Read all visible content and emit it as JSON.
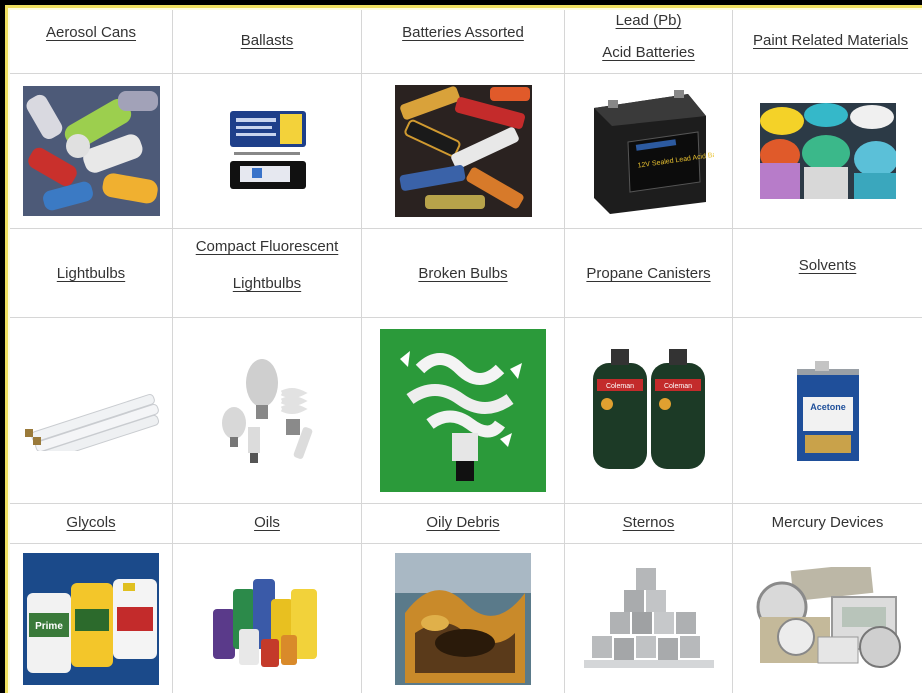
{
  "items": [
    {
      "label": "Aerosol Cans",
      "linked": true
    },
    {
      "label": "Ballasts",
      "linked": true
    },
    {
      "label": "Batteries Assorted",
      "linked": true
    },
    {
      "label_lines": [
        "Lead (Pb)",
        "Acid Batteries"
      ],
      "linked": true
    },
    {
      "label": "Paint Related Materials",
      "linked": true
    },
    {
      "label": "Lightbulbs",
      "linked": true
    },
    {
      "label_lines": [
        "Compact Fluorescent",
        "Lightbulbs"
      ],
      "linked": true
    },
    {
      "label": "Broken Bulbs",
      "linked": true
    },
    {
      "label": "Propane Canisters",
      "linked": true
    },
    {
      "label": "Solvents",
      "linked": true
    },
    {
      "label": "Glycols",
      "linked": true
    },
    {
      "label": "Oils",
      "linked": true
    },
    {
      "label": "Oily Debris",
      "linked": true
    },
    {
      "label": "Sternos",
      "linked": true
    },
    {
      "label": "Mercury Devices",
      "linked": false
    }
  ],
  "image_text": {
    "battery_label": "12V Sealed Lead Acid Battery",
    "acetone_label": "Acetone",
    "coleman_label": "Coleman",
    "prime_label": "Prime"
  },
  "colors": {
    "frame": "#000000",
    "panel": "#fffde0",
    "panel_edge": "#f0e060",
    "grid_line": "#d6d6d6",
    "text": "#333333"
  }
}
